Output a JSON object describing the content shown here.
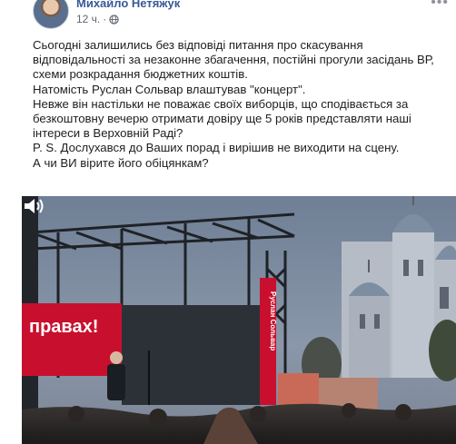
{
  "post": {
    "author": "Михайло Нетяжук",
    "time": "12 ч.",
    "separator": "·",
    "privacy_icon": "globe-icon",
    "more_icon": "more-options-icon",
    "more_symbol": "•••"
  },
  "text": {
    "line1": "Сьогодні залишились без відповіді питання про скасування",
    "line2": "відповідальності за незаконне збагачення, постійні прогули засідань ВР,",
    "line3": "схеми розкрадання бюджетних коштів.",
    "line4": "Натомість Руслан Сольвар влаштував \"концерт\".",
    "line5": "Невже він настільки не поважає своїх виборців, що сподівається за",
    "line6": "безкоштовну вечерю отримати довіру ще 5 років представляти наші",
    "line7": "інтереси в Верховній Раді?",
    "line8": "P. S. Дослухався до Ваших порад і вирішив не виходити на сцену.",
    "line9": "А чи ВИ вірите його обіцянкам?"
  },
  "video": {
    "banner_text": "правах!",
    "side_banner_text": "Руслан Сольвар",
    "sound_icon": "sound-on-icon"
  }
}
